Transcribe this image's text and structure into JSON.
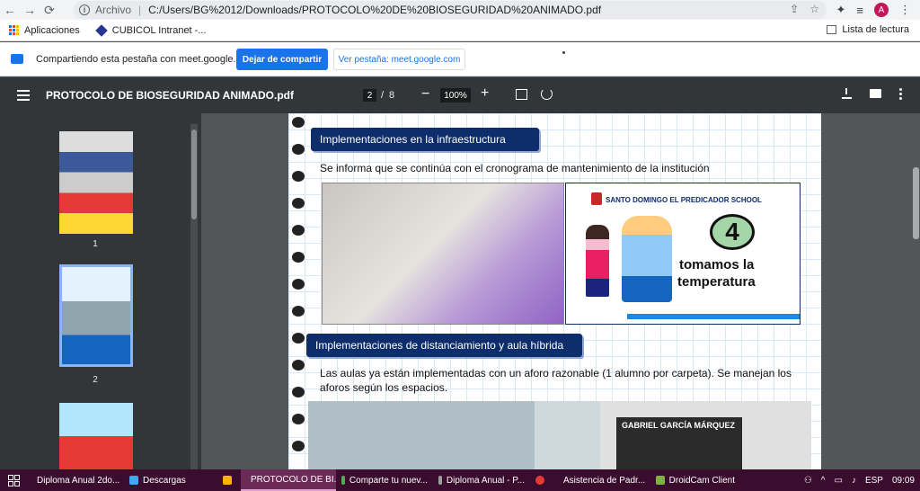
{
  "browser": {
    "address_scheme": "Archivo",
    "url": "C:/Users/BG%2012/Downloads/PROTOCOLO%20DE%20BIOSEGURIDAD%20ANIMADO.pdf",
    "avatar_letter": "A"
  },
  "bookmarks": {
    "items": [
      {
        "label": "Aplicaciones"
      },
      {
        "label": "CUBICOL Intranet -..."
      }
    ],
    "reading_list": "Lista de lectura"
  },
  "share_bar": {
    "text": "Compartiendo esta pestaña con meet.google.com",
    "stop_label": "Dejar de compartir",
    "view_label": "Ver pestaña: meet.google.com"
  },
  "pdf_toolbar": {
    "title": "PROTOCOLO DE BIOSEGURIDAD ANIMADO.pdf",
    "current_page": "2",
    "separator": "/",
    "total_pages": "8",
    "zoom": "100%"
  },
  "thumbnails": [
    {
      "label": "1"
    },
    {
      "label": "2",
      "selected": true
    },
    {
      "label": ""
    }
  ],
  "document": {
    "section1_title": "Implementaciones en la infraestructura",
    "section1_text": "Se informa que se continúa con el cronograma de mantenimiento de la institución",
    "poster_school": "SANTO DOMINGO EL PREDICADOR SCHOOL",
    "poster_number": "4",
    "poster_line1": "tomamos la",
    "poster_line2": "temperatura",
    "section2_title": "Implementaciones de distanciamiento y aula híbrida",
    "section2_text": "Las aulas ya están implementadas con un aforo razonable (1 alumno por carpeta). Se manejan los aforos según los espacios.",
    "banner_text": "GABRIEL GARCÍA MÁRQUEZ"
  },
  "taskbar": {
    "items": [
      {
        "label": "Diploma Anual 2do...",
        "color": "#f9a825"
      },
      {
        "label": "Descargas",
        "color": "#42a5f5"
      },
      {
        "label": "",
        "color": "#ffb300"
      },
      {
        "label": "PROTOCOLO DE BI...",
        "color": "#e53935",
        "active": true
      },
      {
        "label": "Comparte tu nuev...",
        "color": "#4caf50"
      },
      {
        "label": "Diploma Anual - P...",
        "color": "#9e9e9e"
      },
      {
        "label": "",
        "color": "#e53935"
      },
      {
        "label": "Asistencia de Padr...",
        "color": "#1e88e5"
      },
      {
        "label": "DroidCam Client",
        "color": "#7cb342"
      }
    ],
    "language": "ESP",
    "time": "09:09"
  },
  "colors": {
    "accent": "#1a73e8",
    "taskbar": "#3a0d2e",
    "section_title_bg": "#0d2d6b"
  }
}
